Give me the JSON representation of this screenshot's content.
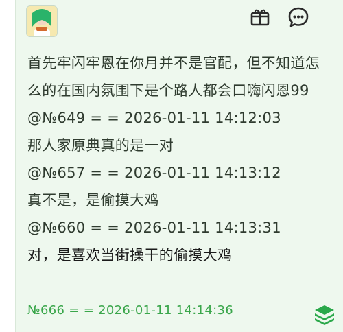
{
  "post": {
    "lines": [
      "首先牢闪牢恩在你月并不是官配，但不知道怎么的在国内氛围下是个路人都会口嗨闪恩99",
      "@№649 = = 2026-01-11 14:12:03",
      "那人家原典真的是一对",
      "@№657 = = 2026-01-11 14:13:12",
      "真不是，是偷摸大鸡",
      "@№660 = = 2026-01-11 14:13:31",
      "对，是喜欢当街操干的偷摸大鸡"
    ],
    "footer_meta": "№666 = = 2026-01-11 14:14:36"
  },
  "icons": {
    "gift": "gift-icon",
    "comment": "chat-bubble-icon",
    "stack": "layers-icon"
  },
  "colors": {
    "background": "#eef8ee",
    "accent": "#3aa64b",
    "text": "#2f3b2f"
  }
}
